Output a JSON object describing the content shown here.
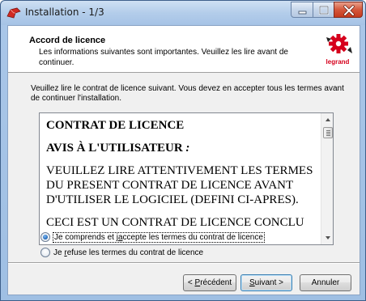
{
  "window": {
    "title": "Installation - 1/3"
  },
  "header": {
    "title": "Accord de licence",
    "subtitle": "Les informations suivantes sont importantes. Veuillez les lire avant de continuer.",
    "logo_text": "legrand"
  },
  "intro": "Veuillez lire le contrat de licence suivant. Vous devez en accepter tous les termes avant de continuer l'installation.",
  "license": {
    "heading": "CONTRAT DE LICENCE",
    "notice_prefix": "AVIS À L'UTILISATEUR",
    "notice_suffix": " :",
    "paragraph1": "VEUILLEZ LIRE ATTENTIVEMENT LES TERMES DU PRESENT CONTRAT DE LICENCE AVANT D'UTILISER LE LOGICIEL (DEFINI CI-APRES).",
    "paragraph2_partial": "CECI EST UN CONTRAT DE LICENCE CONCLU"
  },
  "options": {
    "accept": {
      "prefix": "Je comprends et j",
      "access_key": "a",
      "suffix": "ccepte les termes du contrat de licence",
      "selected": true
    },
    "refuse": {
      "prefix": "Je ",
      "access_key": "r",
      "suffix": "efuse les termes du contrat de licence",
      "selected": false
    }
  },
  "buttons": {
    "back": {
      "prefix": "< ",
      "access_key": "P",
      "suffix": "récédent"
    },
    "next": {
      "access_key": "S",
      "suffix": "uivant >"
    },
    "cancel": "Annuler"
  },
  "colors": {
    "logo_red": "#d6001c",
    "close_button": "#c53a1d",
    "radio_selected": "#2a6fbf"
  }
}
